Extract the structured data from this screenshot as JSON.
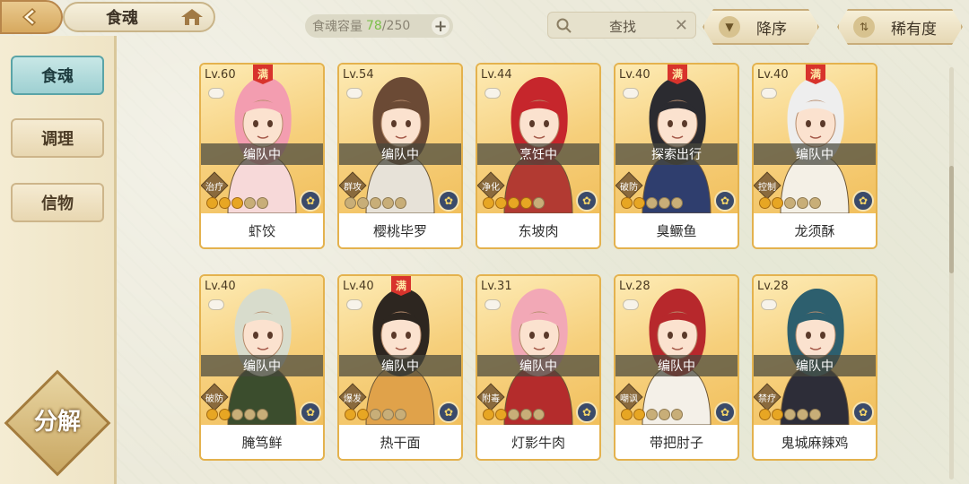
{
  "header": {
    "title": "食魂",
    "capacity_label": "食魂容量",
    "capacity_current": "78",
    "capacity_max": "/250",
    "search_placeholder": "查找",
    "sort_order": "降序",
    "sort_key": "稀有度"
  },
  "sidebar": {
    "tabs": [
      {
        "label": "食魂",
        "active": true
      },
      {
        "label": "调理",
        "active": false
      },
      {
        "label": "信物",
        "active": false
      }
    ],
    "decompose_label": "分解"
  },
  "full_badge": "满",
  "cards": [
    {
      "level": "Lv.60",
      "full": true,
      "status": "编队中",
      "role": "治疗",
      "stars": 3,
      "name": "虾饺",
      "hair": "#f39db0",
      "outfit": "#f7d9d9"
    },
    {
      "level": "Lv.54",
      "full": false,
      "status": "编队中",
      "role": "群攻",
      "stars": 0,
      "name": "樱桃毕罗",
      "hair": "#6b4a35",
      "outfit": "#e7e2d8"
    },
    {
      "level": "Lv.44",
      "full": false,
      "status": "烹饪中",
      "role": "净化",
      "stars": 4,
      "name": "东坡肉",
      "hair": "#c6262c",
      "outfit": "#b23a32"
    },
    {
      "level": "Lv.40",
      "full": true,
      "status": "探索出行",
      "role": "破防",
      "stars": 2,
      "name": "臭鳜鱼",
      "hair": "#2b2b30",
      "outfit": "#2f3e6e"
    },
    {
      "level": "Lv.40",
      "full": true,
      "status": "编队中",
      "role": "控制",
      "stars": 2,
      "name": "龙须酥",
      "hair": "#eeeeee",
      "outfit": "#f4f0e6"
    },
    {
      "level": "Lv.40",
      "full": false,
      "status": "编队中",
      "role": "破防",
      "stars": 2,
      "name": "腌笃鲜",
      "hair": "#d8dccc",
      "outfit": "#3b4d2d"
    },
    {
      "level": "Lv.40",
      "full": true,
      "status": "编队中",
      "role": "爆发",
      "stars": 2,
      "name": "热干面",
      "hair": "#2d2620",
      "outfit": "#e0a24a"
    },
    {
      "level": "Lv.31",
      "full": false,
      "status": "编队中",
      "role": "附毒",
      "stars": 2,
      "name": "灯影牛肉",
      "hair": "#f2a8b6",
      "outfit": "#b42c2c"
    },
    {
      "level": "Lv.28",
      "full": false,
      "status": "编队中",
      "role": "嘲讽",
      "stars": 2,
      "name": "带把肘子",
      "hair": "#b7282c",
      "outfit": "#f4f0e8"
    },
    {
      "level": "Lv.28",
      "full": false,
      "status": "编队中",
      "role": "禁疗",
      "stars": 2,
      "name": "鬼城麻辣鸡",
      "hair": "#2d5f6e",
      "outfit": "#2d2d38"
    }
  ],
  "colors": {
    "accent_teal": "#9ed0d2",
    "card_gold": "#f3c96a",
    "full_badge_red": "#d8332c"
  },
  "icons": [
    "back-arrow-icon",
    "home-icon",
    "search-icon",
    "clear-icon",
    "plus-icon",
    "sort-triangle-icon",
    "sort-rarity-icon",
    "emblem-icon"
  ]
}
